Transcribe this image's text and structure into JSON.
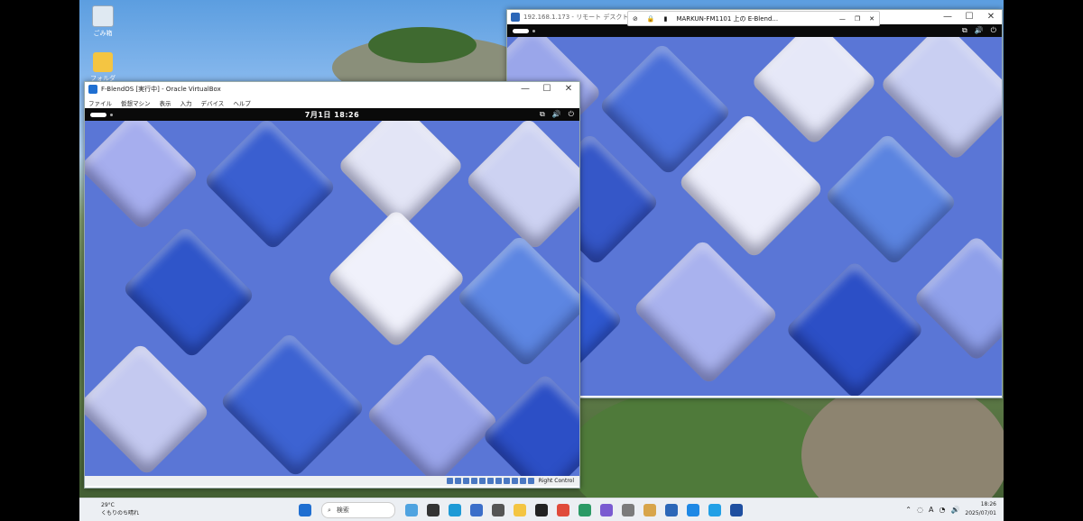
{
  "desktop": {
    "icons": [
      {
        "label": "ごみ箱",
        "icon": "recycle-bin-icon"
      },
      {
        "label": "フォルダ",
        "icon": "folder-icon"
      }
    ]
  },
  "vbox_window": {
    "title": "F-BlendOS [実行中] - Oracle VirtualBox",
    "menu": [
      "ファイル",
      "仮想マシン",
      "表示",
      "入力",
      "デバイス",
      "ヘルプ"
    ],
    "guest_clock": "7月1日  18:26",
    "status_text": "Right Control",
    "window_buttons": {
      "minimize": "—",
      "maximize": "☐",
      "close": "✕"
    }
  },
  "rdp_window": {
    "title": "192.168.1.173 - リモート デスクトップ接続",
    "connection_label": "MARKUN-FM1101 上の E-Blend...",
    "window_buttons": {
      "minimize": "—",
      "maximize": "☐",
      "close": "✕"
    },
    "bar_buttons": {
      "minimize": "—",
      "restore": "❐",
      "close": "✕"
    }
  },
  "taskbar": {
    "weather_temp": "29°C",
    "weather_desc": "くもりのち晴れ",
    "search_placeholder": "検索",
    "time": "18:26",
    "date": "2025/07/01",
    "ime": "A"
  },
  "colors": {
    "taskbar_bg": "#eceff3",
    "guest_topbar": "#0a0a0a",
    "accent": "#1f6fd1"
  }
}
